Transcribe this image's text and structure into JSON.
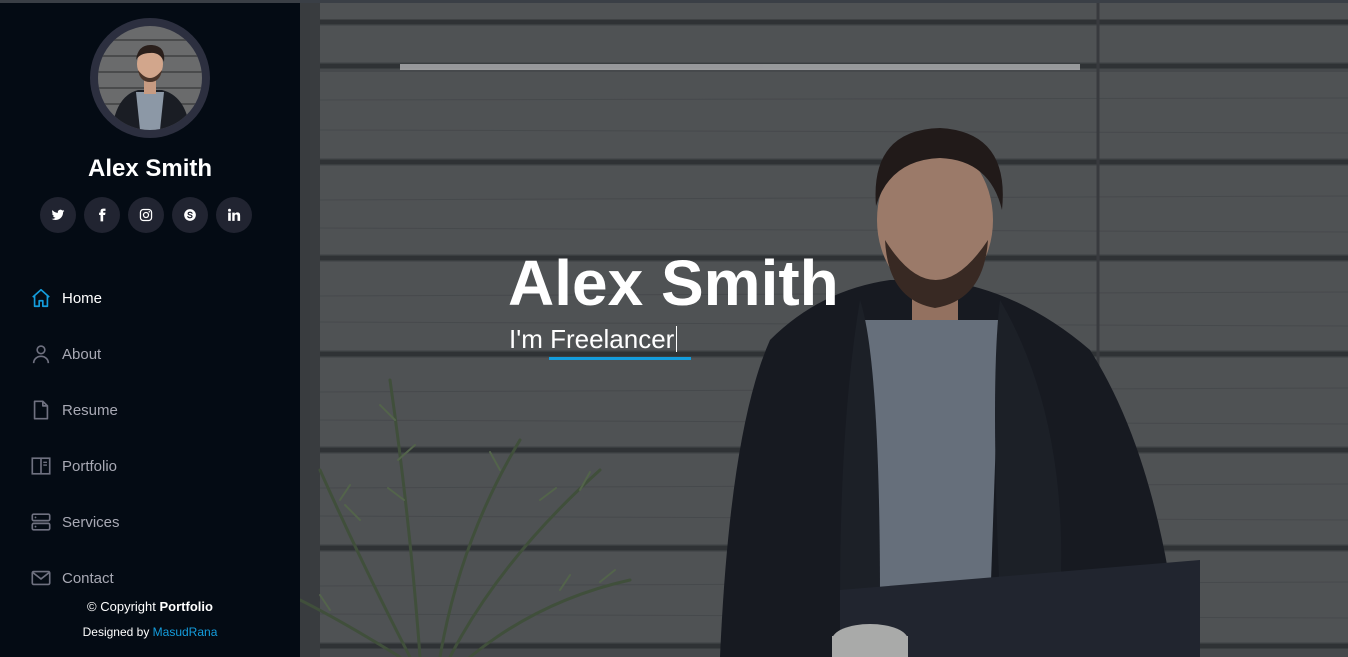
{
  "profile": {
    "name": "Alex Smith"
  },
  "socials": [
    {
      "icon": "twitter-icon"
    },
    {
      "icon": "facebook-icon"
    },
    {
      "icon": "instagram-icon"
    },
    {
      "icon": "skype-icon"
    },
    {
      "icon": "linkedin-icon"
    }
  ],
  "nav": {
    "home": "Home",
    "about": "About",
    "resume": "Resume",
    "portfolio": "Portfolio",
    "services": "Services",
    "contact": "Contact"
  },
  "footer": {
    "copyright_prefix": "© Copyright ",
    "copyright_brand": "Portfolio",
    "designed_by_prefix": "Designed by ",
    "designer": "MasudRana"
  },
  "hero": {
    "title": "Alex Smith",
    "subtitle": "I'm Freelancer"
  },
  "colors": {
    "accent": "#149ddd",
    "sidebar_bg": "#040b14",
    "social_bg": "#212431"
  }
}
